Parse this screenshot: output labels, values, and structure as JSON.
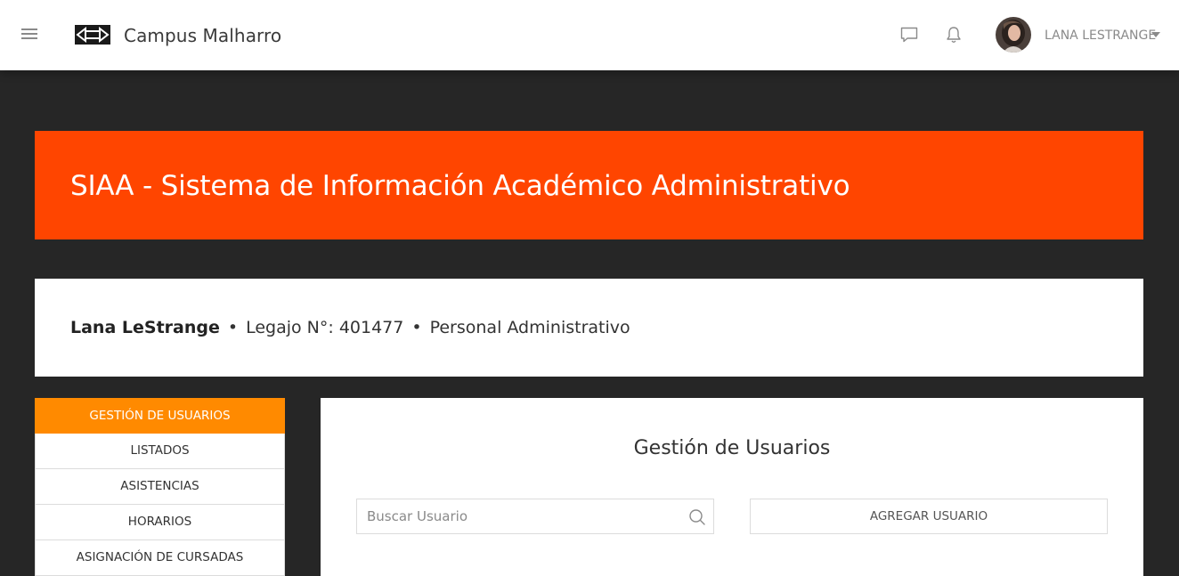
{
  "navbar": {
    "brand": "Campus Malharro",
    "icons": {
      "menu": "hamburger-menu-icon",
      "logo": "campus-logo-icon",
      "messages": "chat-icon",
      "notifications": "bell-icon",
      "dropdown": "caret-down-icon"
    },
    "user_name": "LANA LESTRANGE"
  },
  "banner": {
    "title": "SIAA - Sistema de Información Académico Administrativo",
    "color": "#ff4500"
  },
  "profile": {
    "name": "Lana LeStrange",
    "separator": "•",
    "legajo": "Legajo N°: 401477",
    "role": "Personal Administrativo"
  },
  "sidebar": {
    "active_color": "#ff8a00",
    "items": [
      {
        "label": "GESTIÓN DE USUARIOS",
        "active": true
      },
      {
        "label": "LISTADOS",
        "active": false
      },
      {
        "label": "ASISTENCIAS",
        "active": false
      },
      {
        "label": "HORARIOS",
        "active": false
      },
      {
        "label": "ASIGNACIÓN DE CURSADAS",
        "active": false
      }
    ]
  },
  "main": {
    "title": "Gestión de Usuarios",
    "search": {
      "placeholder": "Buscar Usuario",
      "value": "",
      "icon": "search-icon"
    },
    "add_button": "AGREGAR USUARIO"
  },
  "colors": {
    "background": "#262626",
    "panel": "#ffffff"
  }
}
